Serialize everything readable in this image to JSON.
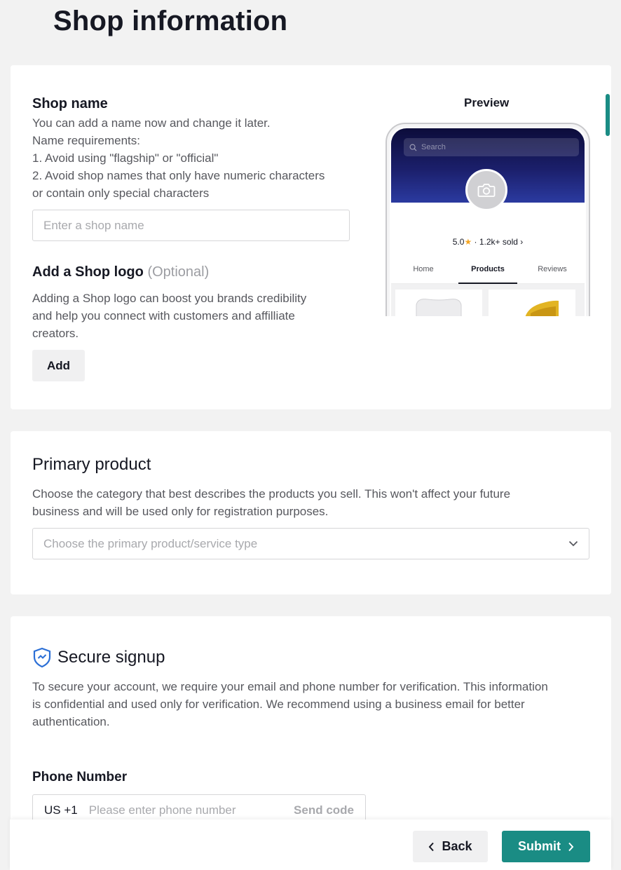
{
  "page": {
    "title": "Shop information"
  },
  "shop_name": {
    "heading": "Shop name",
    "desc_lines": [
      "You can add a name now and change it later.",
      "Name requirements:",
      "1. Avoid using \"flagship\" or \"official\"",
      "2. Avoid shop names that only have numeric characters",
      "or contain only special characters"
    ],
    "placeholder": "Enter a shop name"
  },
  "shop_logo": {
    "heading": "Add a Shop logo",
    "optional": "(Optional)",
    "desc_lines": [
      "Adding a Shop logo can boost you brands credibility",
      "and help you connect with customers and affilliate",
      "creators."
    ],
    "add_label": "Add"
  },
  "preview": {
    "label": "Preview",
    "search_placeholder": "Search",
    "rating": "5.0",
    "sold": "· 1.2k+ sold ›",
    "tabs": [
      "Home",
      "Products",
      "Reviews"
    ],
    "active_tab": "Products"
  },
  "primary_product": {
    "heading": "Primary product",
    "desc_lines": [
      "Choose the category that best describes the products you sell. This won't affect your future",
      "business and will be used only for registration purposes."
    ],
    "placeholder": "Choose the primary product/service type"
  },
  "secure_signup": {
    "heading": "Secure signup",
    "desc_lines": [
      "To secure your account, we require your email and phone number for verification. This information",
      "is confidential and used only for verification. We recommend using a business email for better",
      "authentication."
    ],
    "phone_label": "Phone Number",
    "country_code": "US +1",
    "phone_placeholder": "Please enter phone number",
    "send_code": "Send code"
  },
  "footer": {
    "back_label": "Back",
    "submit_label": "Submit"
  },
  "colors": {
    "accent": "#1a8c84",
    "shield": "#2b6fd6",
    "star": "#f5a623"
  }
}
